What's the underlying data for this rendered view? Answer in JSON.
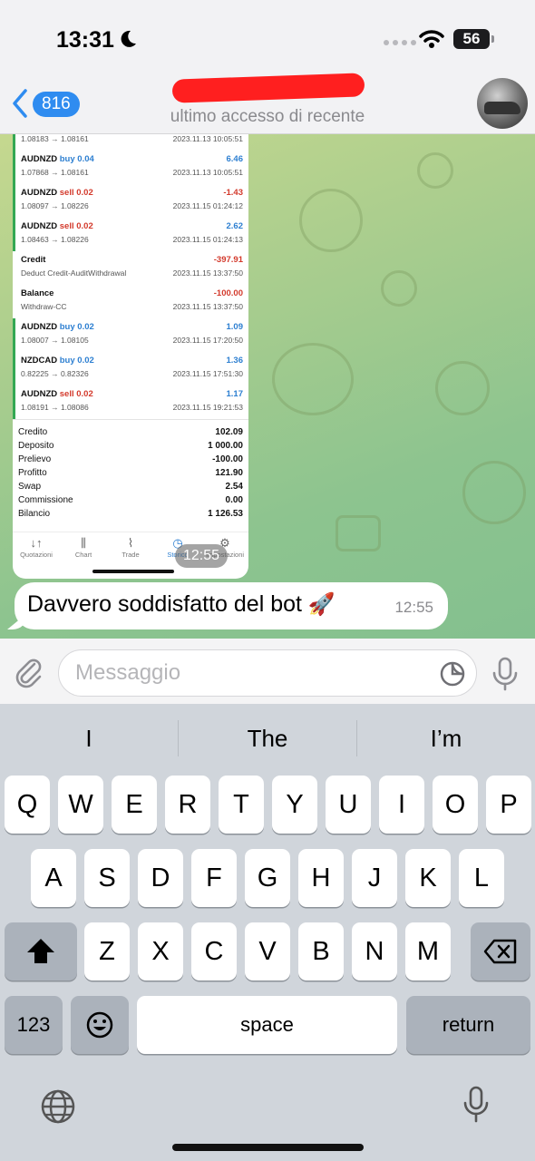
{
  "status_bar": {
    "time": "13:31",
    "battery": "56"
  },
  "header": {
    "back_count": "816",
    "contact_name": "",
    "subtitle": "ultimo accesso di recente"
  },
  "trades": [
    {
      "symbol": "AUDNZD",
      "direction": "buy",
      "volume": "0.04",
      "prices": "1.07868 → 1.08161",
      "datetime": "2023.11.13 10:05:51",
      "profit": "6.46",
      "profit_sign": "pos"
    },
    {
      "symbol": "AUDNZD",
      "direction": "sell",
      "volume": "0.02",
      "prices": "1.08097 → 1.08226",
      "datetime": "2023.11.15 01:24:12",
      "profit": "-1.43",
      "profit_sign": "neg"
    },
    {
      "symbol": "AUDNZD",
      "direction": "sell",
      "volume": "0.02",
      "prices": "1.08463 → 1.08226",
      "datetime": "2023.11.15 01:24:13",
      "profit": "2.62",
      "profit_sign": "pos"
    },
    {
      "symbol": "Credit",
      "direction": "",
      "volume": "",
      "prices": "Deduct Credit-AuditWithdrawal",
      "datetime": "2023.11.15 13:37:50",
      "profit": "-397.91",
      "profit_sign": "neg"
    },
    {
      "symbol": "Balance",
      "direction": "",
      "volume": "",
      "prices": "Withdraw-CC",
      "datetime": "2023.11.15 13:37:50",
      "profit": "-100.00",
      "profit_sign": "neg"
    },
    {
      "symbol": "AUDNZD",
      "direction": "buy",
      "volume": "0.02",
      "prices": "1.08007 → 1.08105",
      "datetime": "2023.11.15 17:20:50",
      "profit": "1.09",
      "profit_sign": "pos"
    },
    {
      "symbol": "NZDCAD",
      "direction": "buy",
      "volume": "0.02",
      "prices": "0.82225 → 0.82326",
      "datetime": "2023.11.15 17:51:30",
      "profit": "1.36",
      "profit_sign": "pos"
    },
    {
      "symbol": "AUDNZD",
      "direction": "sell",
      "volume": "0.02",
      "prices": "1.08191 → 1.08086",
      "datetime": "2023.11.15 19:21:53",
      "profit": "1.17",
      "profit_sign": "pos"
    }
  ],
  "partial_top_trade": {
    "prices": "1.08183 → 1.08161",
    "datetime": "2023.11.13 10:05:51"
  },
  "summary": [
    {
      "label": "Credito",
      "value": "102.09"
    },
    {
      "label": "Deposito",
      "value": "1 000.00"
    },
    {
      "label": "Prelievo",
      "value": "-100.00"
    },
    {
      "label": "Profitto",
      "value": "121.90"
    },
    {
      "label": "Swap",
      "value": "2.54"
    },
    {
      "label": "Commissione",
      "value": "0.00"
    },
    {
      "label": "Bilancio",
      "value": "1 126.53"
    }
  ],
  "app_tabs": [
    {
      "label": "Quotazioni",
      "icon": "quotes-icon"
    },
    {
      "label": "Chart",
      "icon": "candles-icon"
    },
    {
      "label": "Trade",
      "icon": "trade-icon"
    },
    {
      "label": "Storico",
      "icon": "history-icon"
    },
    {
      "label": "Impostazioni",
      "icon": "settings-icon"
    }
  ],
  "photo_message_time": "12:55",
  "text_message": {
    "text": "Davvero soddisfatto del bot",
    "emoji": "🚀",
    "time": "12:55"
  },
  "input": {
    "placeholder": "Messaggio"
  },
  "keyboard": {
    "suggestions": [
      "I",
      "The",
      "I’m"
    ],
    "row1": [
      "Q",
      "W",
      "E",
      "R",
      "T",
      "Y",
      "U",
      "I",
      "O",
      "P"
    ],
    "row2": [
      "A",
      "S",
      "D",
      "F",
      "G",
      "H",
      "J",
      "K",
      "L"
    ],
    "row3": [
      "Z",
      "X",
      "C",
      "V",
      "B",
      "N",
      "M"
    ],
    "numbers_label": "123",
    "space_label": "space",
    "return_label": "return"
  },
  "colors": {
    "accent": "#2f8cf0",
    "profit_positive": "#2d7fd1",
    "profit_negative": "#d33a2c",
    "redaction": "#ff1f1f"
  }
}
